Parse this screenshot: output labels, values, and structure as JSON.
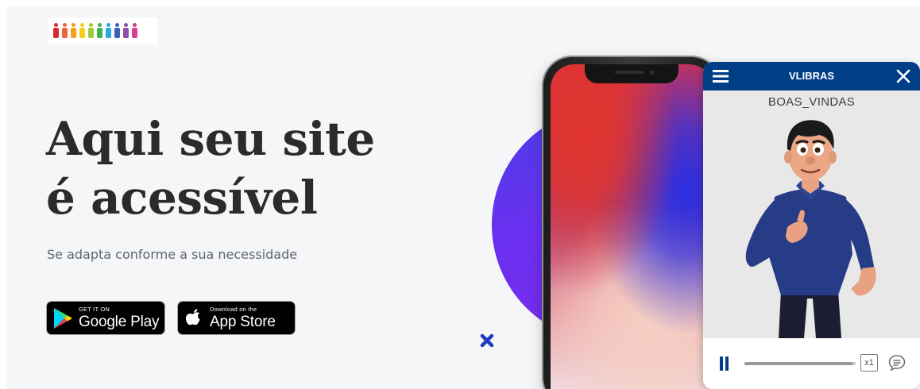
{
  "hero": {
    "headline_line1": "Aqui seu site",
    "headline_line2": "é acessível",
    "subtitle": "Se adapta conforme a sua necessidade"
  },
  "logo": {
    "figure_colors": [
      "#d9282f",
      "#f0643c",
      "#f59f1b",
      "#f4cf1a",
      "#9ccb3b",
      "#3fb34f",
      "#27a9e1",
      "#3f5fb8",
      "#8e4fa6",
      "#d53f8c"
    ]
  },
  "badges": {
    "google": {
      "small": "GET IT ON",
      "big": "Google Play"
    },
    "apple": {
      "small": "Download on the",
      "big": "App Store"
    }
  },
  "vlibras": {
    "title": "VLIBRAS",
    "gloss": "BOAS_VINDAS",
    "speed": "x1",
    "progress": 0.97,
    "icons": {
      "menu": "hamburger-menu-icon",
      "close": "close-icon",
      "pause": "pause-icon",
      "subtitles": "speech-bubble-icon"
    }
  },
  "colors": {
    "accent_blue": "#003f86",
    "purple": "#6c2ff0",
    "headline": "#2b2b2b",
    "decor_x": "#1f3cc4"
  }
}
